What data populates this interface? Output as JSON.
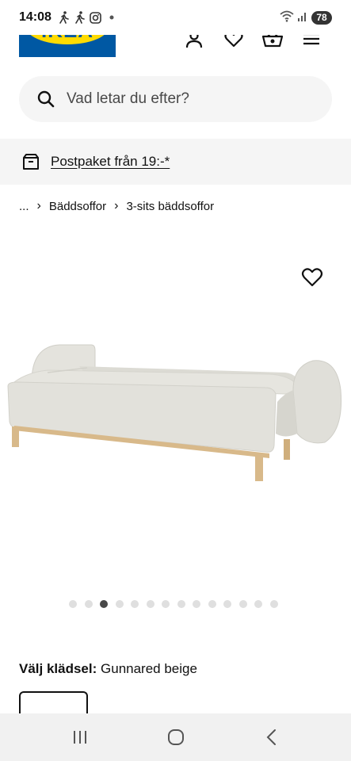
{
  "status_bar": {
    "time": "14:08",
    "battery": "78",
    "icons": [
      "walk-icon",
      "walk-icon",
      "instagram-icon",
      "dot-icon",
      "wifi-icon",
      "signal-icon"
    ]
  },
  "header": {
    "logo": "IKEA",
    "icons": [
      "profile-icon",
      "heart-icon",
      "basket-icon",
      "menu-icon"
    ]
  },
  "search": {
    "placeholder": "Vad letar du efter?"
  },
  "promo": {
    "text": "Postpaket från 19:-*"
  },
  "breadcrumb": {
    "items": [
      "...",
      "Bäddsoffor",
      "3-sits bäddsoffor"
    ]
  },
  "product": {
    "carousel": {
      "total": 14,
      "active_index": 2
    }
  },
  "fabric": {
    "label": "Välj klädsel:",
    "value": "Gunnared beige"
  },
  "colors": {
    "ikea_blue": "#0058a3",
    "ikea_yellow": "#ffdb00",
    "sofa_fabric": "#e2e1db",
    "wood": "#d8b98a"
  }
}
